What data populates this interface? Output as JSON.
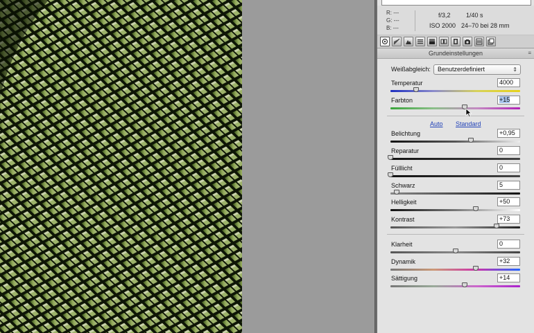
{
  "info": {
    "rgb": {
      "r": "R:  ---",
      "g": "G:  ---",
      "b": "B:  ---"
    },
    "exif": {
      "aperture": "f/3,2",
      "shutter": "1/40 s",
      "iso": "ISO 2000",
      "lens": "24–70 bei 28 mm"
    }
  },
  "toolbar": {
    "tools": [
      "basic-tab-icon",
      "tone-curve-icon",
      "detail-icon",
      "hsl-icon",
      "split-toning-icon",
      "lens-corrections-icon",
      "effects-icon",
      "camera-calibration-icon",
      "presets-icon",
      "snapshots-icon"
    ]
  },
  "section": {
    "title": "Grundeinstellungen",
    "menu_glyph": "≡"
  },
  "white_balance": {
    "label": "Weißabgleich:",
    "value": "Benutzerdefiniert",
    "arrow": "⌃⌄"
  },
  "links": {
    "auto": "Auto",
    "standard": "Standard"
  },
  "sliders": {
    "temperatur": {
      "label": "Temperatur",
      "value": "4000",
      "level": 0.2
    },
    "farbton": {
      "label": "Farbton",
      "value": "+15",
      "level": 0.57
    },
    "belichtung": {
      "label": "Belichtung",
      "value": "+0,95",
      "level": 0.62
    },
    "reparatur": {
      "label": "Reparatur",
      "value": "0",
      "level": 0.0
    },
    "fuelllicht": {
      "label": "Fülllicht",
      "value": "0",
      "level": 0.0
    },
    "schwarz": {
      "label": "Schwarz",
      "value": "5",
      "level": 0.05
    },
    "helligkeit": {
      "label": "Helligkeit",
      "value": "+50",
      "level": 0.66
    },
    "kontrast": {
      "label": "Kontrast",
      "value": "+73",
      "level": 0.82
    },
    "klarheit": {
      "label": "Klarheit",
      "value": "0",
      "level": 0.5
    },
    "dynamik": {
      "label": "Dynamik",
      "value": "+32",
      "level": 0.66
    },
    "saettigung": {
      "label": "Sättigung",
      "value": "+14",
      "level": 0.57
    }
  }
}
